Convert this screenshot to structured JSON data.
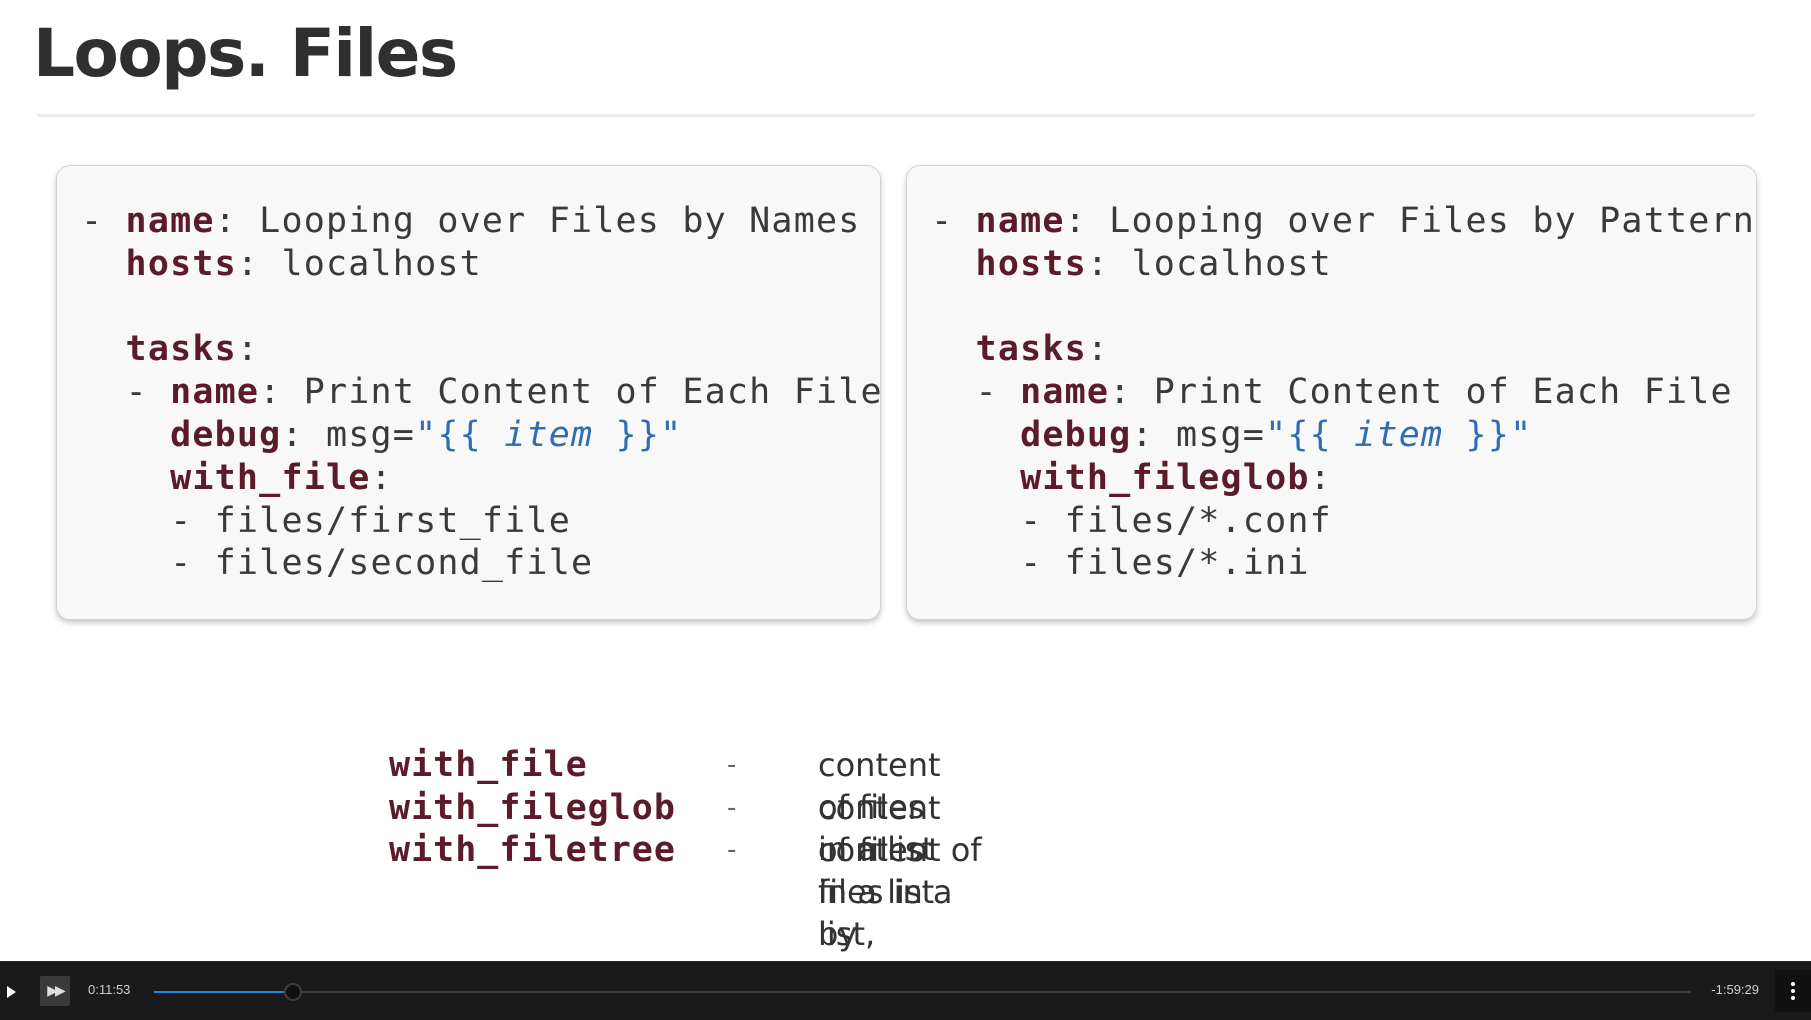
{
  "slide": {
    "title": "Loops. Files",
    "left_code": [
      [
        {
          "c": "t",
          "v": "- "
        },
        {
          "c": "k",
          "v": "name"
        },
        {
          "c": "t",
          "v": ": Looping over Files by Names"
        }
      ],
      [
        {
          "c": "t",
          "v": "  "
        },
        {
          "c": "k",
          "v": "hosts"
        },
        {
          "c": "t",
          "v": ": localhost"
        }
      ],
      [],
      [
        {
          "c": "t",
          "v": "  "
        },
        {
          "c": "k",
          "v": "tasks"
        },
        {
          "c": "t",
          "v": ":"
        }
      ],
      [
        {
          "c": "t",
          "v": "  - "
        },
        {
          "c": "k",
          "v": "name"
        },
        {
          "c": "t",
          "v": ": Print Content of Each File"
        }
      ],
      [
        {
          "c": "t",
          "v": "    "
        },
        {
          "c": "k",
          "v": "debug"
        },
        {
          "c": "t",
          "v": ": msg="
        },
        {
          "c": "s",
          "v": "\"{{ "
        },
        {
          "c": "si",
          "v": "item"
        },
        {
          "c": "s",
          "v": " }}\""
        }
      ],
      [
        {
          "c": "t",
          "v": "    "
        },
        {
          "c": "k",
          "v": "with_file"
        },
        {
          "c": "t",
          "v": ":"
        }
      ],
      [
        {
          "c": "t",
          "v": "    - files/first_file"
        }
      ],
      [
        {
          "c": "t",
          "v": "    - files/second_file"
        }
      ]
    ],
    "right_code": [
      [
        {
          "c": "t",
          "v": "- "
        },
        {
          "c": "k",
          "v": "name"
        },
        {
          "c": "t",
          "v": ": Looping over Files by Pattern"
        }
      ],
      [
        {
          "c": "t",
          "v": "  "
        },
        {
          "c": "k",
          "v": "hosts"
        },
        {
          "c": "t",
          "v": ": localhost"
        }
      ],
      [],
      [
        {
          "c": "t",
          "v": "  "
        },
        {
          "c": "k",
          "v": "tasks"
        },
        {
          "c": "t",
          "v": ":"
        }
      ],
      [
        {
          "c": "t",
          "v": "  - "
        },
        {
          "c": "k",
          "v": "name"
        },
        {
          "c": "t",
          "v": ": Print Content of Each File"
        }
      ],
      [
        {
          "c": "t",
          "v": "    "
        },
        {
          "c": "k",
          "v": "debug"
        },
        {
          "c": "t",
          "v": ": msg="
        },
        {
          "c": "s",
          "v": "\"{{ "
        },
        {
          "c": "si",
          "v": "item"
        },
        {
          "c": "s",
          "v": " }}\""
        }
      ],
      [
        {
          "c": "t",
          "v": "    "
        },
        {
          "c": "k",
          "v": "with_fileglob"
        },
        {
          "c": "t",
          "v": ":"
        }
      ],
      [
        {
          "c": "t",
          "v": "    - files/*.conf"
        }
      ],
      [
        {
          "c": "t",
          "v": "    - files/*.ini"
        }
      ]
    ],
    "legend": [
      {
        "term": "with_file",
        "dash": "-",
        "desc": "content of files in a list"
      },
      {
        "term": "with_fileglob",
        "dash": "-",
        "desc": "content of files in a list by pattern"
      },
      {
        "term": "with_filetree",
        "dash": "-",
        "desc": "content of files in a list, recursively"
      }
    ]
  },
  "player": {
    "current_time": "0:11:53",
    "remaining_time": "-1:59:29",
    "progress": 0.0905
  },
  "colors": {
    "keyword": "#5b1b2a",
    "string": "#2e6db3",
    "progress": "#1e88e5",
    "player_bg": "#1a1a1a"
  },
  "icons": {
    "play": "play-icon",
    "skip": "skip-forward-icon",
    "menu": "more-vertical-icon"
  }
}
